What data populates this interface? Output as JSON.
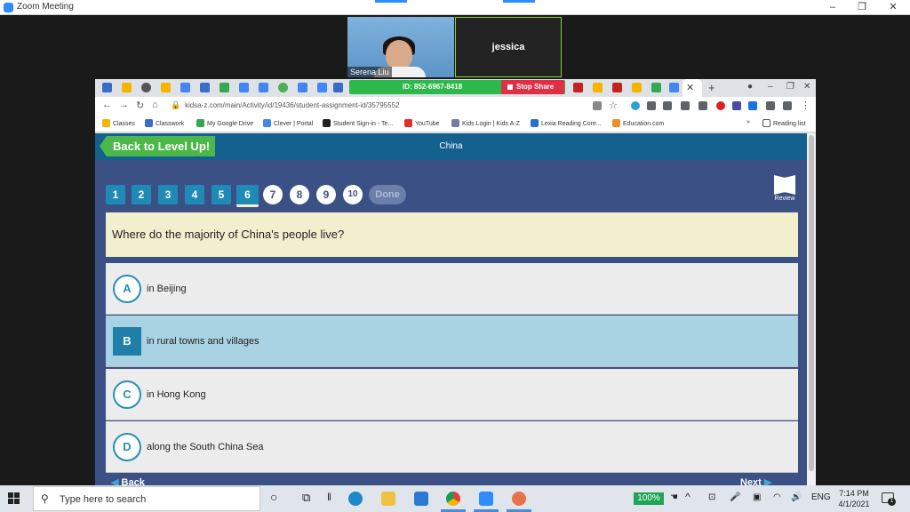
{
  "zoom": {
    "window_title": "Zoom Meeting",
    "participants": [
      {
        "name": "Serena Liu"
      },
      {
        "name": "jessica"
      }
    ]
  },
  "browser": {
    "share_id": "ID: 852-6967-8418",
    "stop_share_label": "Stop Share",
    "url": "kidsa-z.com/main/Activity/id/19436/student-assignment-id/35795552",
    "bookmarks": [
      "Classes",
      "Classwork",
      "My Google Drive",
      "Clever | Portal",
      "Student Sign-in - Te...",
      "YouTube",
      "Kids Login | Kids A-Z",
      "Lexia Reading Core...",
      "Education.com"
    ],
    "reading_list": "Reading list"
  },
  "activity": {
    "back_label": "Back to Level Up!",
    "page_title": "China",
    "question_numbers": [
      "1",
      "2",
      "3",
      "4",
      "5",
      "6",
      "7",
      "8",
      "9",
      "10"
    ],
    "current_question": 6,
    "done_label": "Done",
    "review_label": "Review",
    "question": "Where do the majority of China's people live?",
    "answers": [
      {
        "letter": "A",
        "text": "in Beijing"
      },
      {
        "letter": "B",
        "text": "in rural towns and villages"
      },
      {
        "letter": "C",
        "text": "in Hong Kong"
      },
      {
        "letter": "D",
        "text": "along the South China Sea"
      }
    ],
    "selected_answer": "B",
    "nav_back": "Back",
    "nav_next": "Next"
  },
  "taskbar": {
    "search_placeholder": "Type here to search",
    "zoom_percent": "100%",
    "language": "ENG",
    "time": "7:14 PM",
    "date": "4/1/2021",
    "notifications": "1"
  },
  "colors": {
    "page_bg": "#3b5186",
    "header_bg": "#14608e",
    "back_button": "#4cb84a",
    "question_bg": "#f2efce",
    "selected_answer_bg": "#a9d2e2",
    "share_bar": "#2db84b",
    "stop_share": "#e02f44"
  }
}
